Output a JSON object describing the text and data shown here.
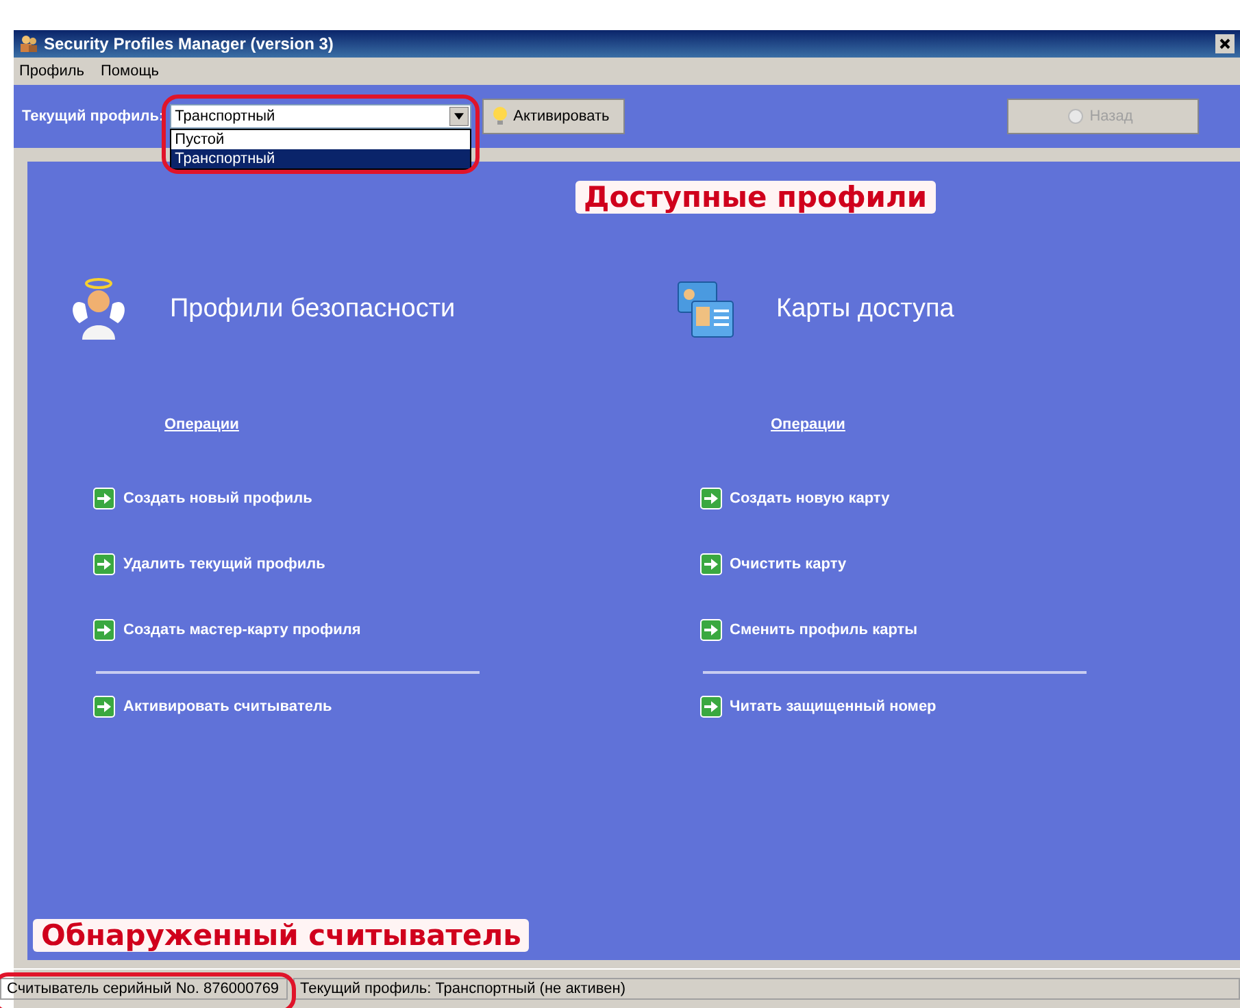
{
  "window": {
    "title": "Security Profiles Manager (version 3)"
  },
  "menu": [
    {
      "label": "Профиль"
    },
    {
      "label": "Помощь"
    }
  ],
  "toolbar": {
    "profile_label": "Текущий профиль:",
    "profile_value": "Транспортный",
    "options": [
      {
        "label": "Пустой",
        "selected": false
      },
      {
        "label": "Транспортный",
        "selected": true
      }
    ],
    "activate_button": "Активировать",
    "back_button": {
      "label": "Назад",
      "disabled": true
    }
  },
  "available_note": "Доступные профили",
  "sections": [
    {
      "kind": "profiles",
      "title": "Профили безопасности",
      "operations_heading": "Операции",
      "operations": [
        "Создать новый профиль",
        "Удалить текущий профиль",
        "Создать мастер-карту профиля"
      ],
      "extra": "Активировать считыватель"
    },
    {
      "kind": "cards",
      "title": "Карты доступа",
      "operations_heading": "Операции",
      "operations": [
        "Создать новую карту",
        "Очистить карту",
        "Сменить профиль карты"
      ],
      "extra": "Читать защищенный номер"
    }
  ],
  "reader_note": "Обнаруженный считыватель",
  "status_bar": {
    "serial": "Считыватель серийный No. 876000769",
    "profile": "Текущий профиль:  Транспортный  (не активен)"
  }
}
